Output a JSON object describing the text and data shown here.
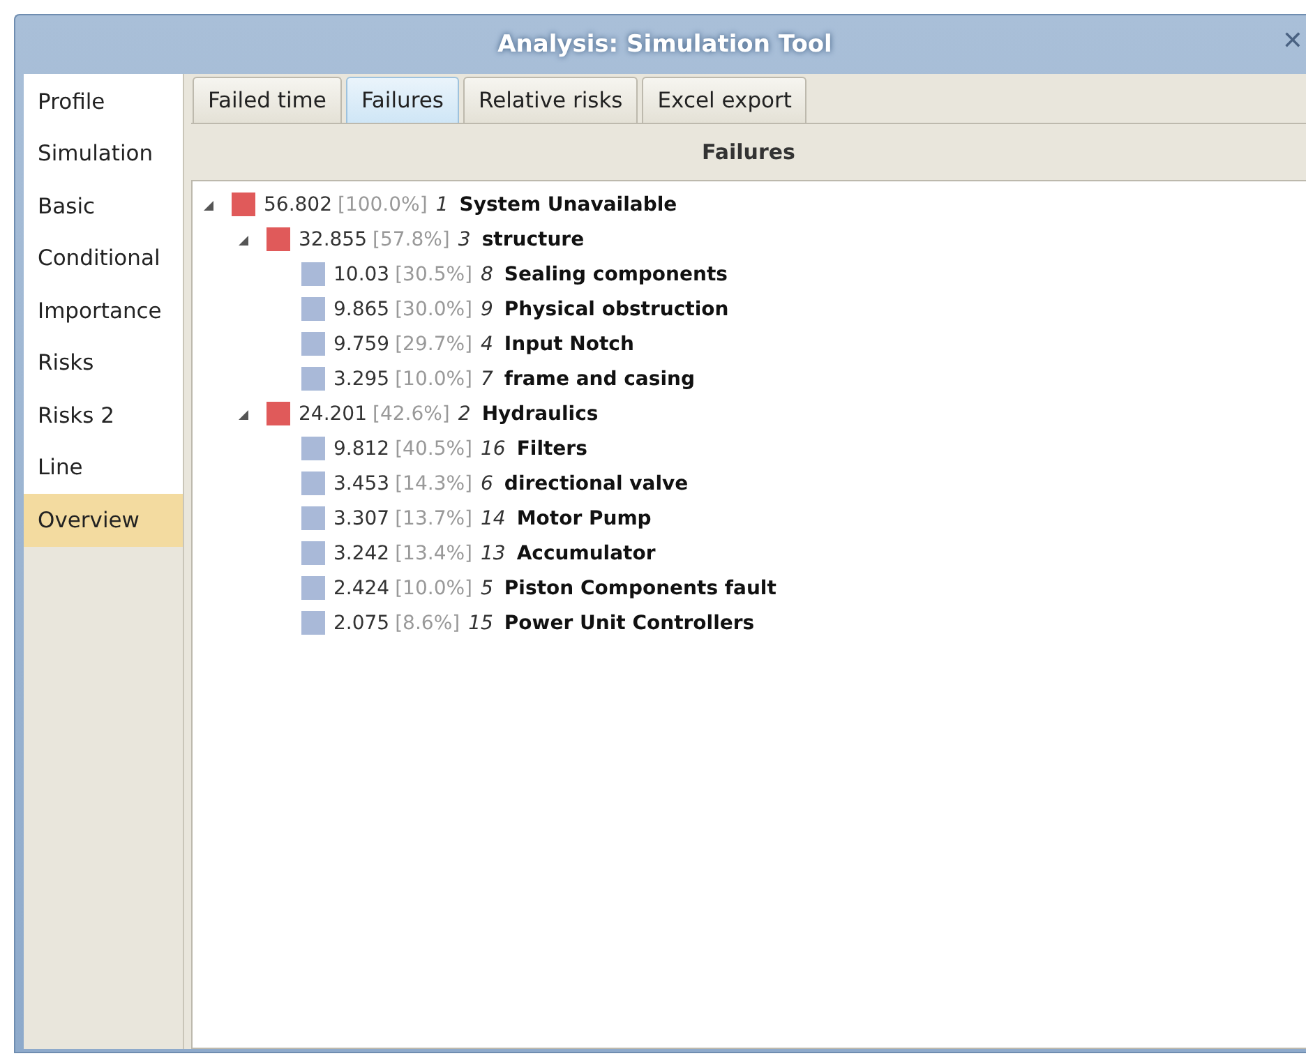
{
  "window": {
    "title": "Analysis: Simulation Tool",
    "close": "✕"
  },
  "sidebar": {
    "items": [
      {
        "label": "Profile",
        "selected": false
      },
      {
        "label": "Simulation",
        "selected": false
      },
      {
        "label": "Basic",
        "selected": false
      },
      {
        "label": "Conditional",
        "selected": false
      },
      {
        "label": "Importance",
        "selected": false
      },
      {
        "label": "Risks",
        "selected": false
      },
      {
        "label": "Risks 2",
        "selected": false
      },
      {
        "label": "Line",
        "selected": false
      },
      {
        "label": "Overview",
        "selected": true
      }
    ]
  },
  "tabs": [
    {
      "label": "Failed time",
      "selected": false
    },
    {
      "label": "Failures",
      "selected": true
    },
    {
      "label": "Relative risks",
      "selected": false
    },
    {
      "label": "Excel export",
      "selected": false
    }
  ],
  "panel": {
    "header": "Failures"
  },
  "tree": [
    {
      "value": "56.802",
      "percent": "[100.0%]",
      "index": "1",
      "name": "System Unavailable",
      "color": "#e05a5a",
      "expanded": true,
      "children": [
        {
          "value": "32.855",
          "percent": "[57.8%]",
          "index": "3",
          "name": "structure",
          "color": "#e05a5a",
          "expanded": true,
          "children": [
            {
              "value": "10.03",
              "percent": "[30.5%]",
              "index": "8",
              "name": "Sealing components",
              "color": "#a9b9d8"
            },
            {
              "value": "9.865",
              "percent": "[30.0%]",
              "index": "9",
              "name": "Physical obstruction",
              "color": "#a9b9d8"
            },
            {
              "value": "9.759",
              "percent": "[29.7%]",
              "index": "4",
              "name": "Input Notch",
              "color": "#a9b9d8"
            },
            {
              "value": "3.295",
              "percent": "[10.0%]",
              "index": "7",
              "name": "frame and casing",
              "color": "#a9b9d8"
            }
          ]
        },
        {
          "value": "24.201",
          "percent": "[42.6%]",
          "index": "2",
          "name": "Hydraulics",
          "color": "#e05a5a",
          "expanded": true,
          "children": [
            {
              "value": "9.812",
              "percent": "[40.5%]",
              "index": "16",
              "name": "Filters",
              "color": "#a9b9d8"
            },
            {
              "value": "3.453",
              "percent": "[14.3%]",
              "index": "6",
              "name": "directional valve",
              "color": "#a9b9d8"
            },
            {
              "value": "3.307",
              "percent": "[13.7%]",
              "index": "14",
              "name": "Motor Pump",
              "color": "#a9b9d8"
            },
            {
              "value": "3.242",
              "percent": "[13.4%]",
              "index": "13",
              "name": "Accumulator",
              "color": "#a9b9d8"
            },
            {
              "value": "2.424",
              "percent": "[10.0%]",
              "index": "5",
              "name": "Piston Components fault",
              "color": "#a9b9d8"
            },
            {
              "value": "2.075",
              "percent": "[8.6%]",
              "index": "15",
              "name": "Power Unit Controllers",
              "color": "#a9b9d8"
            }
          ]
        }
      ]
    }
  ]
}
